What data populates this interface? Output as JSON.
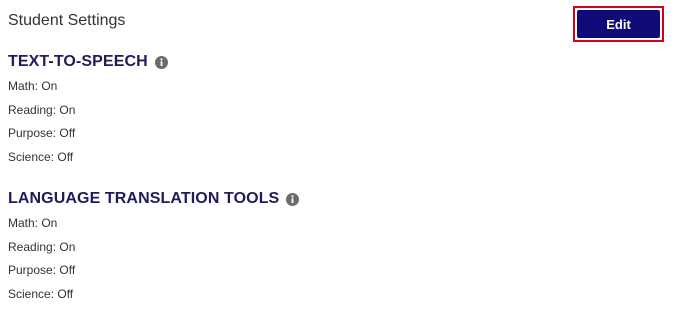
{
  "header": {
    "title": "Student Settings",
    "edit_label": "Edit"
  },
  "colors": {
    "button_bg": "#0f0a78",
    "button_text": "#ffffff",
    "focus_outline": "#d0021b",
    "heading": "#1e1c5a",
    "body_text": "#333333",
    "icon": "#6b6b6b"
  },
  "sections": [
    {
      "title": "TEXT-TO-SPEECH",
      "icon": "info-icon",
      "items": [
        "Math: On",
        "Reading: On",
        "Purpose: Off",
        "Science: Off"
      ]
    },
    {
      "title": "LANGUAGE TRANSLATION TOOLS",
      "icon": "info-icon",
      "items": [
        "Math: On",
        "Reading: On",
        "Purpose: Off",
        "Science: Off"
      ]
    }
  ]
}
